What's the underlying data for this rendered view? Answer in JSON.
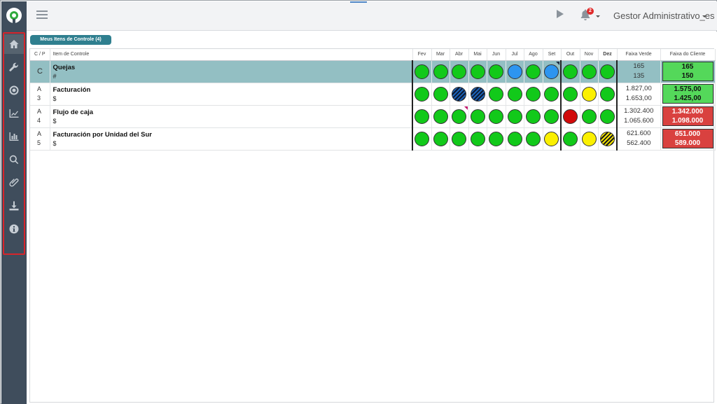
{
  "topbar": {
    "notification_count": "2",
    "user_name": "Gestor Administrativo_es"
  },
  "sidebar": {
    "items": [
      {
        "icon": "home-icon",
        "active": true
      },
      {
        "icon": "wrench-icon"
      },
      {
        "icon": "target-icon"
      },
      {
        "icon": "line-chart-icon"
      },
      {
        "icon": "bar-chart-icon"
      },
      {
        "icon": "search-icon"
      },
      {
        "icon": "paperclip-icon"
      },
      {
        "icon": "download-icon"
      },
      {
        "icon": "info-icon"
      }
    ]
  },
  "tab": {
    "label": "Meus Itens de Controle (4)"
  },
  "table": {
    "headers": {
      "cp": "C / P",
      "item": "Item de Controle",
      "months": [
        "Fev",
        "Mar",
        "Abr",
        "Mai",
        "Jun",
        "Jul",
        "Ago",
        "Set",
        "Out",
        "Nov",
        "Dez"
      ],
      "faixa_verde": "Faixa Verde",
      "faixa_cliente": "Faixa do Cliente"
    },
    "rows": [
      {
        "selected": true,
        "cp_top": "C",
        "cp_bottom": "",
        "name": "Quejas",
        "unit": "#",
        "status": [
          "green",
          "green",
          "green",
          "green",
          "green",
          "blue",
          "green",
          "blue",
          "green",
          "green",
          "green"
        ],
        "flags": {
          "7": "dark"
        },
        "faixa_verde": [
          "165",
          "135"
        ],
        "faixa_cliente": [
          "165",
          "150"
        ],
        "cliente_color": "green"
      },
      {
        "cp_top": "A",
        "cp_bottom": "3",
        "name": "Facturación",
        "unit": "$",
        "status": [
          "green",
          "green",
          "hatch-blue",
          "hatch-blue",
          "green",
          "green",
          "green",
          "green",
          "green",
          "yellow",
          "green"
        ],
        "flags": {},
        "faixa_verde": [
          "1.827,00",
          "1.653,00"
        ],
        "faixa_cliente": [
          "1.575,00",
          "1.425,00"
        ],
        "cliente_color": "green"
      },
      {
        "cp_top": "A",
        "cp_bottom": "4",
        "name": "Flujo de caja",
        "unit": "$",
        "status": [
          "green",
          "green",
          "green",
          "green",
          "green",
          "green",
          "green",
          "green",
          "red",
          "green",
          "green"
        ],
        "flags": {
          "2": "magenta"
        },
        "faixa_verde": [
          "1.302.400",
          "1.065.600"
        ],
        "faixa_cliente": [
          "1.342.000",
          "1.098.000"
        ],
        "cliente_color": "red"
      },
      {
        "cp_top": "A",
        "cp_bottom": "5",
        "name": "Facturación por Unidad del Sur",
        "unit": "$",
        "status": [
          "green",
          "green",
          "green",
          "green",
          "green",
          "green",
          "green",
          "yellow",
          "green",
          "yellow",
          "hatch-yellow"
        ],
        "flags": {},
        "faixa_verde": [
          "621.600",
          "562.400"
        ],
        "faixa_cliente": [
          "651.000",
          "589.000"
        ],
        "cliente_color": "red"
      }
    ]
  }
}
